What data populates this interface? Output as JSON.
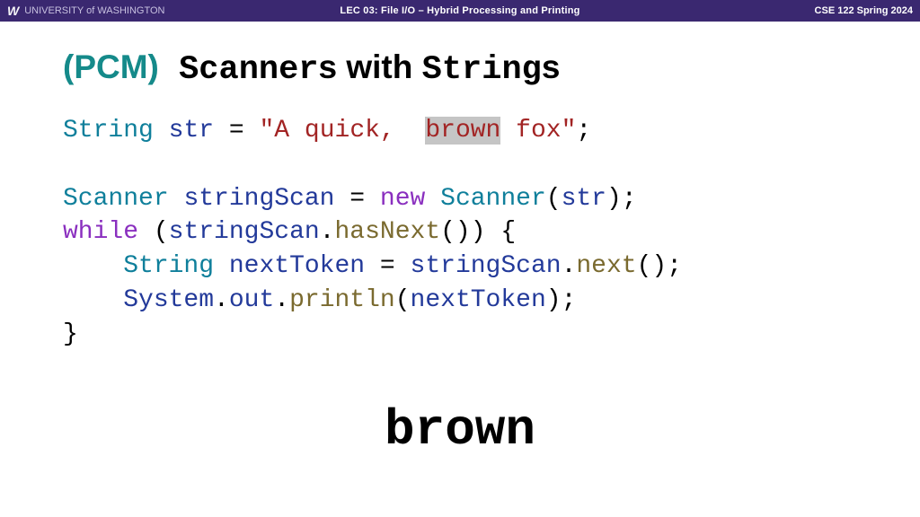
{
  "topbar": {
    "logo_letter": "W",
    "university": "UNIVERSITY of WASHINGTON",
    "lecture": "LEC 03: File I/O – Hybrid Processing and Printing",
    "course": "CSE 122 Spring 2024"
  },
  "title": {
    "pcm": "(PCM)",
    "word1": " Scanner",
    "word1_suffix": "s",
    "word2": " with ",
    "word3": "String",
    "word3_suffix": "s"
  },
  "code": {
    "l1": {
      "t_string": "String",
      "sp1": " ",
      "v_str": "str",
      "sp2": " ",
      "eq": "=",
      "sp3": " ",
      "lit_a": "\"A quick,  ",
      "hl": "brown",
      "lit_b": " fox\"",
      "semi": ";"
    },
    "l3": {
      "t_scanner": "Scanner",
      "sp1": " ",
      "v_scan": "stringScan",
      "sp2": " ",
      "eq": "=",
      "sp3": " ",
      "kw_new": "new",
      "sp4": " ",
      "ctor": "Scanner",
      "lp": "(",
      "arg": "str",
      "rp": ")",
      "semi": ";"
    },
    "l4": {
      "kw_while": "while",
      "sp1": " ",
      "lp": "(",
      "obj": "stringScan",
      "dot": ".",
      "meth": "hasNext",
      "lp2": "(",
      "rp2": ")",
      "rp": ")",
      "sp2": " ",
      "lb": "{"
    },
    "l5": {
      "indent": "    ",
      "t_string": "String",
      "sp1": " ",
      "v_tok": "nextToken",
      "sp2": " ",
      "eq": "=",
      "sp3": " ",
      "obj": "stringScan",
      "dot": ".",
      "meth": "next",
      "lp": "(",
      "rp": ")",
      "semi": ";"
    },
    "l6": {
      "indent": "    ",
      "sys": "System",
      "dot1": ".",
      "out": "out",
      "dot2": ".",
      "meth": "println",
      "lp": "(",
      "arg": "nextToken",
      "rp": ")",
      "semi": ";"
    },
    "l7": {
      "rb": "}"
    }
  },
  "output": "brown"
}
